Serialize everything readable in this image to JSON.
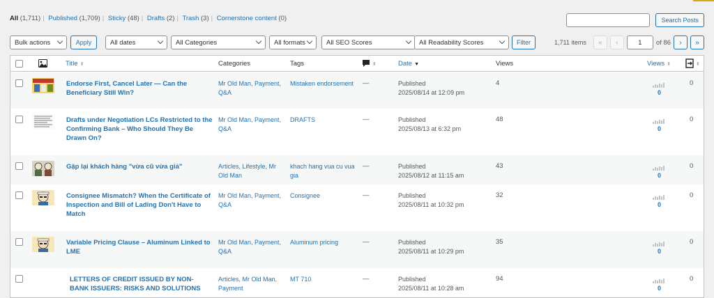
{
  "filters": [
    {
      "label": "All",
      "count": "(1,711)",
      "current": true
    },
    {
      "label": "Published",
      "count": "(1,709)"
    },
    {
      "label": "Sticky",
      "count": "(48)"
    },
    {
      "label": "Drafts",
      "count": "(2)"
    },
    {
      "label": "Trash",
      "count": "(3)"
    },
    {
      "label": "Cornerstone content",
      "count": "(0)"
    }
  ],
  "search": {
    "value": "",
    "button": "Search Posts"
  },
  "toolbar": {
    "bulk_actions": "Bulk actions",
    "apply": "Apply",
    "dates": "All dates",
    "categories": "All Categories",
    "formats": "All formats",
    "seo": "All SEO Scores",
    "readability": "All Readability Scores",
    "filter": "Filter"
  },
  "pagination": {
    "items": "1,711 items",
    "first": "«",
    "prev": "‹",
    "current_page": "1",
    "of": "of 86",
    "next": "›",
    "last": "»"
  },
  "columns": {
    "title": "Title",
    "categories": "Categories",
    "tags": "Tags",
    "date": "Date",
    "views": "Views",
    "views2": "Views",
    "sort_icon": "⬍",
    "sort_icon_active": "▼"
  },
  "icons": {
    "image_col": "image-icon",
    "comments_col": "comment-bubble-icon",
    "links_col": "internal-links-icon"
  },
  "posts": [
    {
      "title": "Endorse First, Cancel Later — Can the Beneficiary Still Win?",
      "categories": "Mr Old Man, Payment, Q&A",
      "tags": "Mistaken endorsement",
      "comments": "—",
      "status": "Published",
      "date": "2025/08/14 at 12:09 pm",
      "views": "4",
      "views_stat": "0",
      "links": "0",
      "thumb": "comic-yellow"
    },
    {
      "title": "Drafts under Negotiation LCs Restricted to the Confirming Bank – Who Should They Be Drawn On?",
      "categories": "Mr Old Man, Payment, Q&A",
      "tags": "DRAFTS",
      "comments": "—",
      "status": "Published",
      "date": "2025/08/13 at 6:32 pm",
      "views": "48",
      "views_stat": "0",
      "links": "0",
      "thumb": "document"
    },
    {
      "title": "Gặp lại khách hàng \"vừa cũ vừa giả\"",
      "categories": "Articles, Lifestyle, Mr Old Man",
      "tags": "khach hang vua cu vua gia",
      "comments": "—",
      "status": "Published",
      "date": "2025/08/12 at 11:15 am",
      "views": "43",
      "views_stat": "0",
      "links": "0",
      "thumb": "comic-pair"
    },
    {
      "title": "Consignee Mismatch? When the Certificate of Inspection and Bill of Lading Don't Have to Match",
      "categories": "Mr Old Man, Payment, Q&A",
      "tags": "Consignee",
      "comments": "—",
      "status": "Published",
      "date": "2025/08/11 at 10:32 pm",
      "views": "32",
      "views_stat": "0",
      "links": "0",
      "thumb": "old-man"
    },
    {
      "title": "Variable Pricing Clause – Aluminum Linked to LME",
      "categories": "Mr Old Man, Payment, Q&A",
      "tags": "Aluminum pricing",
      "comments": "—",
      "status": "Published",
      "date": "2025/08/11 at 10:29 pm",
      "views": "35",
      "views_stat": "0",
      "links": "0",
      "thumb": "old-man"
    },
    {
      "title": "LETTERS OF CREDIT ISSUED BY NON-BANK ISSUERS: RISKS AND SOLUTIONS",
      "categories": "Articles, Mr Old Man, Payment",
      "tags": "MT 710",
      "comments": "—",
      "status": "Published",
      "date": "2025/08/11 at 10:28 am",
      "views": "94",
      "views_stat": "0",
      "links": "0",
      "thumb": "none"
    }
  ]
}
